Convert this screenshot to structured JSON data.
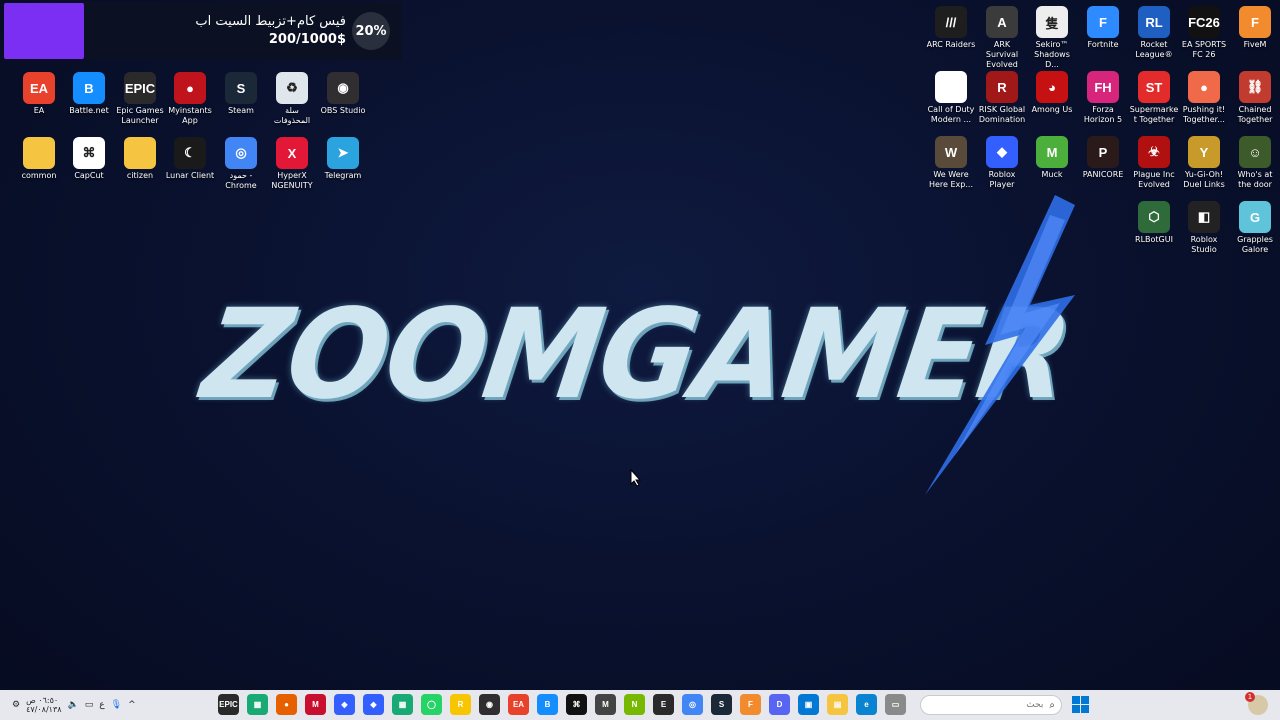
{
  "donation": {
    "title": "فيس كام+تزبيط السيت اب",
    "goal": "200/1000$",
    "percent": "20%",
    "color": "#7b2ff2"
  },
  "desktop_left": [
    {
      "label": "EA",
      "icon": "ea-icon",
      "color": "#e8412c",
      "abbr": "EA"
    },
    {
      "label": "Battle.net",
      "icon": "battlenet-icon",
      "color": "#148eff",
      "abbr": "B"
    },
    {
      "label": "Epic Games Launcher",
      "icon": "epic-games-icon",
      "color": "#2a2a2a",
      "abbr": "EPIC"
    },
    {
      "label": "Myinstants App",
      "icon": "myinstants-icon",
      "color": "#c0141c",
      "abbr": "●"
    },
    {
      "label": "Steam",
      "icon": "steam-icon",
      "color": "#1b2838",
      "abbr": "S"
    },
    {
      "label": "سلة المحذوفات",
      "icon": "recycle-bin-icon",
      "color": "#dfe6ec",
      "abbr": "♻"
    },
    {
      "label": "OBS Studio",
      "icon": "obs-icon",
      "color": "#302e31",
      "abbr": "◉"
    },
    {
      "label": "common",
      "icon": "folder-icon",
      "color": "#f5c542",
      "abbr": ""
    },
    {
      "label": "CapCut",
      "icon": "capcut-icon",
      "color": "#ffffff",
      "abbr": "⌘"
    },
    {
      "label": "citizen",
      "icon": "folder-icon",
      "color": "#f5c542",
      "abbr": ""
    },
    {
      "label": "Lunar Client",
      "icon": "lunar-client-icon",
      "color": "#1a1a1a",
      "abbr": "☾"
    },
    {
      "label": "حمود - Chrome",
      "icon": "chrome-icon",
      "color": "#4285f4",
      "abbr": "◎"
    },
    {
      "label": "HyperX NGENUITY",
      "icon": "hyperx-icon",
      "color": "#e31837",
      "abbr": "X"
    },
    {
      "label": "Telegram",
      "icon": "telegram-icon",
      "color": "#2aa3df",
      "abbr": "➤"
    }
  ],
  "desktop_right": [
    {
      "label": "ARC Raiders",
      "icon": "arc-raiders-icon",
      "color": "#1e1e1e",
      "abbr": "///"
    },
    {
      "label": "ARK Survival Evolved",
      "icon": "ark-icon",
      "color": "#3b3b3b",
      "abbr": "A"
    },
    {
      "label": "Sekiro™ Shadows D...",
      "icon": "sekiro-icon",
      "color": "#eeeeee",
      "abbr": "隻"
    },
    {
      "label": "Fortnite",
      "icon": "fortnite-icon",
      "color": "#2e8bff",
      "abbr": "F"
    },
    {
      "label": "Rocket League®",
      "icon": "rocket-league-icon",
      "color": "#1f5fc2",
      "abbr": "RL"
    },
    {
      "label": "EA SPORTS FC 26",
      "icon": "fc26-icon",
      "color": "#111111",
      "abbr": "FC26"
    },
    {
      "label": "FiveM",
      "icon": "fivem-icon",
      "color": "#f28a2e",
      "abbr": "F"
    },
    {
      "label": "Call of Duty Modern ...",
      "icon": "file-icon",
      "color": "#ffffff",
      "abbr": ""
    },
    {
      "label": "RISK Global Domination",
      "icon": "risk-icon",
      "color": "#a01818",
      "abbr": "R"
    },
    {
      "label": "Among Us",
      "icon": "among-us-icon",
      "color": "#c51111",
      "abbr": "◕"
    },
    {
      "label": "Forza Horizon 5",
      "icon": "forza-icon",
      "color": "#d6257a",
      "abbr": "FH"
    },
    {
      "label": "Supermarket Together",
      "icon": "supermarket-icon",
      "color": "#e32b2b",
      "abbr": "ST"
    },
    {
      "label": "Pushing it! Together...",
      "icon": "pushing-it-icon",
      "color": "#f06a4a",
      "abbr": "●"
    },
    {
      "label": "Chained Together",
      "icon": "chained-together-icon",
      "color": "#c23b2f",
      "abbr": "⛓"
    },
    {
      "label": "We Were Here Exp...",
      "icon": "we-were-here-icon",
      "color": "#5a4a3a",
      "abbr": "W"
    },
    {
      "label": "Roblox Player",
      "icon": "roblox-player-icon",
      "color": "#335fff",
      "abbr": "◆"
    },
    {
      "label": "Muck",
      "icon": "muck-icon",
      "color": "#4caf3c",
      "abbr": "M"
    },
    {
      "label": "PANICORE",
      "icon": "panicore-icon",
      "color": "#2a1a1a",
      "abbr": "P"
    },
    {
      "label": "Plague Inc Evolved",
      "icon": "plague-inc-icon",
      "color": "#b01010",
      "abbr": "☣"
    },
    {
      "label": "Yu-Gi-Oh! Duel Links",
      "icon": "yugioh-icon",
      "color": "#c79a2a",
      "abbr": "Y"
    },
    {
      "label": "Who's at the door",
      "icon": "whos-at-door-icon",
      "color": "#3c5a2a",
      "abbr": "☺"
    },
    {
      "label": "RLBotGUI",
      "icon": "rlbotgui-icon",
      "color": "#2f6b3a",
      "abbr": "⬡"
    },
    {
      "label": "Roblox Studio",
      "icon": "roblox-studio-icon",
      "color": "#222222",
      "abbr": "◧"
    },
    {
      "label": "Grapples Galore",
      "icon": "grapples-galore-icon",
      "color": "#5fc4d9",
      "abbr": "G"
    }
  ],
  "logo": {
    "text": "ZOOMGAMER",
    "bolt_color": "#2f6fe8"
  },
  "taskbar": {
    "time": "٠٦:٥٠ ص",
    "date": "٤٧/٠٨/١٣٨",
    "lang": "ع",
    "search_placeholder": "بحث",
    "notification_count": "1",
    "apps": [
      {
        "icon": "epic-games-icon",
        "color": "#2a2a2a",
        "abbr": "EPIC"
      },
      {
        "icon": "app-icon",
        "color": "#19a974",
        "abbr": "▦"
      },
      {
        "icon": "firefox-icon",
        "color": "#e66000",
        "abbr": "●"
      },
      {
        "icon": "mcafee-icon",
        "color": "#c8102e",
        "abbr": "M"
      },
      {
        "icon": "roblox-player-icon",
        "color": "#335fff",
        "abbr": "◆"
      },
      {
        "icon": "roblox-studio-icon",
        "color": "#335fff",
        "abbr": "◆"
      },
      {
        "icon": "app2-icon",
        "color": "#19a974",
        "abbr": "▦"
      },
      {
        "icon": "whatsapp-icon",
        "color": "#25d366",
        "abbr": "◯"
      },
      {
        "icon": "rockstar-icon",
        "color": "#f7c600",
        "abbr": "R"
      },
      {
        "icon": "obs-icon",
        "color": "#302e31",
        "abbr": "◉"
      },
      {
        "icon": "ea-icon",
        "color": "#e8412c",
        "abbr": "EA"
      },
      {
        "icon": "battlenet-icon",
        "color": "#148eff",
        "abbr": "B"
      },
      {
        "icon": "capcut-icon",
        "color": "#111111",
        "abbr": "⌘"
      },
      {
        "icon": "myinstants-icon",
        "color": "#444444",
        "abbr": "M"
      },
      {
        "icon": "nvidia-icon",
        "color": "#76b900",
        "abbr": "N"
      },
      {
        "icon": "epic-games-icon",
        "color": "#2a2a2a",
        "abbr": "E"
      },
      {
        "icon": "chrome-icon",
        "color": "#4285f4",
        "abbr": "◎"
      },
      {
        "icon": "steam-icon",
        "color": "#1b2838",
        "abbr": "S"
      },
      {
        "icon": "fivem-icon",
        "color": "#f28a2e",
        "abbr": "F"
      },
      {
        "icon": "discord-icon",
        "color": "#5865f2",
        "abbr": "D"
      },
      {
        "icon": "store-icon",
        "color": "#0078d4",
        "abbr": "▣"
      },
      {
        "icon": "folder-icon",
        "color": "#f5c542",
        "abbr": "▤"
      },
      {
        "icon": "edge-icon",
        "color": "#0a84d0",
        "abbr": "e"
      },
      {
        "icon": "window-icon",
        "color": "#8a8a8a",
        "abbr": "▭"
      }
    ]
  }
}
